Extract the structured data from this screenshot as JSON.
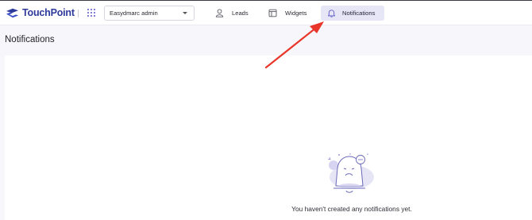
{
  "app": {
    "name": "TouchPoint",
    "brand_color": "#2d3a9a",
    "accent_color": "#5a56c7"
  },
  "header": {
    "account_selector": {
      "value": "Easydmarc admin"
    },
    "nav": [
      {
        "label": "Leads",
        "icon": "user-icon",
        "active": false
      },
      {
        "label": "Widgets",
        "icon": "widget-icon",
        "active": false
      },
      {
        "label": "Notifications",
        "icon": "bell-icon",
        "active": true
      }
    ]
  },
  "page": {
    "title": "Notifications"
  },
  "empty_state": {
    "message": "You haven't created any notifications yet.",
    "icon": "sad-bell-illustration"
  },
  "annotation": {
    "type": "arrow",
    "color": "#e8372a"
  }
}
